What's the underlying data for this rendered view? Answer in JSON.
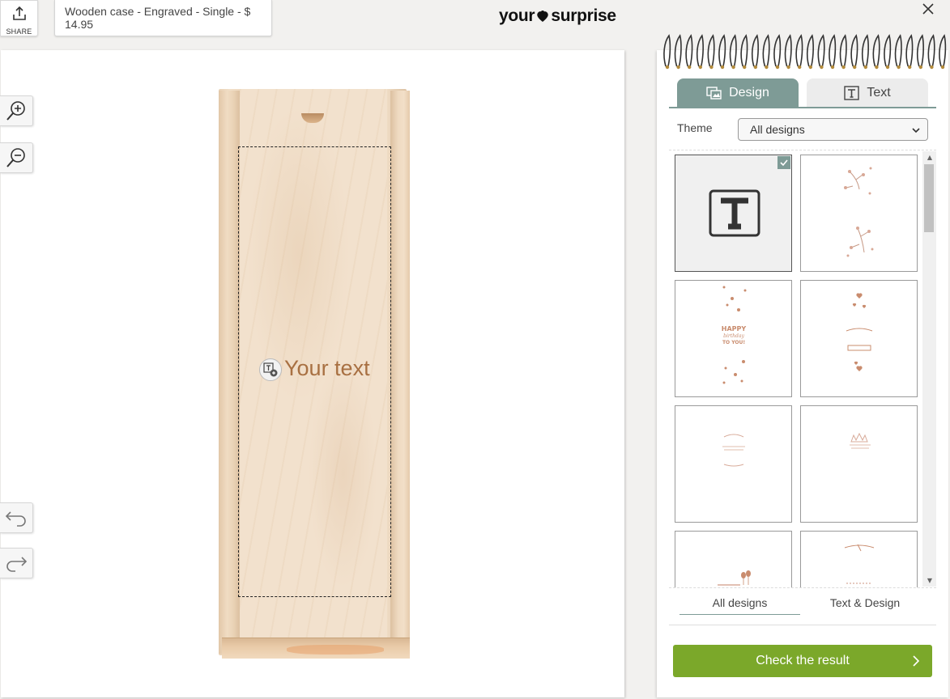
{
  "header": {
    "share_label": "SHARE",
    "product_label": "Wooden case - Engraved - Single - $ 14.95",
    "logo_left": "your",
    "logo_right": "surprise"
  },
  "canvas": {
    "placeholder_text": "Your text"
  },
  "tools": {
    "zoom_in": "zoom-in-icon",
    "zoom_out": "zoom-out-icon",
    "undo": "undo-icon",
    "redo": "redo-icon"
  },
  "panel": {
    "tabs": [
      {
        "label": "Design",
        "icon": "design-icon",
        "active": true
      },
      {
        "label": "Text",
        "icon": "text-icon",
        "active": false
      }
    ],
    "theme_label": "Theme",
    "theme_value": "All designs",
    "designs": [
      {
        "name": "blank-text",
        "selected": true
      },
      {
        "name": "floral-sprigs",
        "selected": false
      },
      {
        "name": "happy-birthday",
        "text": "HAPPY birthday TO YOU!",
        "selected": false
      },
      {
        "name": "hearts-banner",
        "selected": false
      },
      {
        "name": "leaf-lines",
        "selected": false
      },
      {
        "name": "crown-lines",
        "selected": false
      },
      {
        "name": "balloons",
        "selected": false
      },
      {
        "name": "branch-lines",
        "selected": false
      }
    ],
    "sub_tabs": [
      {
        "label": "All designs",
        "active": true
      },
      {
        "label": "Text & Design",
        "active": false
      }
    ],
    "check_button": "Check the result"
  },
  "colors": {
    "accent": "#7e9b96",
    "cta": "#7ba82a",
    "engrave": "#a87042",
    "wood": "#f2e1cd"
  }
}
